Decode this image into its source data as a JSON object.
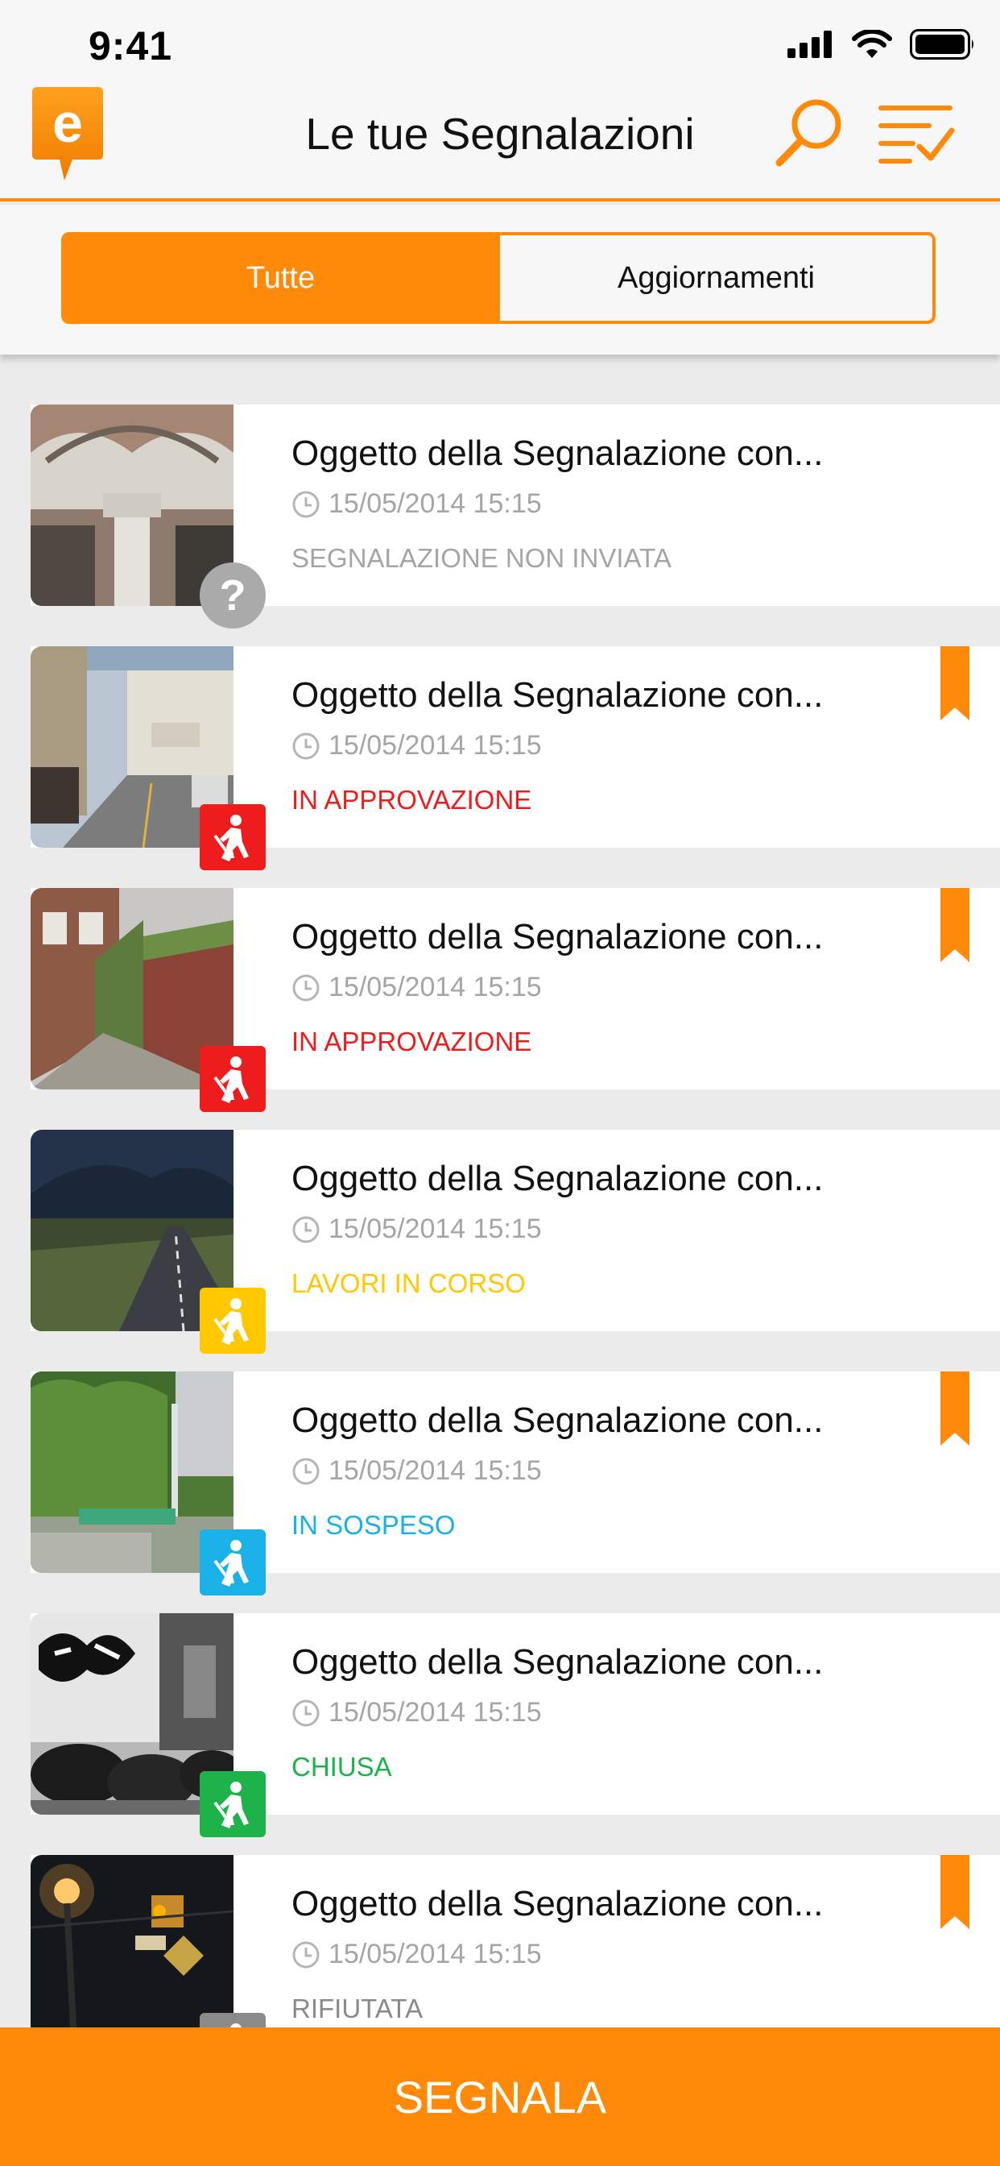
{
  "status_bar": {
    "time": "9:41"
  },
  "header": {
    "title": "Le tue Segnalazioni",
    "logo_letter": "e"
  },
  "tabs": [
    {
      "label": "Tutte",
      "active": true
    },
    {
      "label": "Aggiornamenti",
      "active": false
    }
  ],
  "reports": [
    {
      "title": "Oggetto della Segnalazione con...",
      "timestamp": "15/05/2014 15:15",
      "status": "SEGNALAZIONE NON INVIATA",
      "status_color": "#a5a5a5",
      "badge": "question",
      "badge_color": "#aaaaaa",
      "badge_text": "?",
      "bookmarked": false,
      "photo": "building-column"
    },
    {
      "title": "Oggetto della Segnalazione con...",
      "timestamp": "15/05/2014 15:15",
      "status": "IN APPROVAZIONE",
      "status_color": "#ee1c1c",
      "badge": "worker",
      "badge_color": "#ee1c1c",
      "bookmarked": true,
      "photo": "studio-street"
    },
    {
      "title": "Oggetto della Segnalazione con...",
      "timestamp": "15/05/2014 15:15",
      "status": "IN APPROVAZIONE",
      "status_color": "#ee1c1c",
      "badge": "worker",
      "badge_color": "#ee1c1c",
      "bookmarked": true,
      "photo": "brick-alley"
    },
    {
      "title": "Oggetto della Segnalazione con...",
      "timestamp": "15/05/2014 15:15",
      "status": "LAVORI IN CORSO",
      "status_color": "#ffc800",
      "badge": "worker",
      "badge_color": "#ffc800",
      "bookmarked": false,
      "photo": "mountain-road"
    },
    {
      "title": "Oggetto della Segnalazione con...",
      "timestamp": "15/05/2014 15:15",
      "status": "IN SOSPESO",
      "status_color": "#1ab0e8",
      "badge": "worker",
      "badge_color": "#1ab0e8",
      "bookmarked": true,
      "photo": "bamboo-park"
    },
    {
      "title": "Oggetto della Segnalazione con...",
      "timestamp": "15/05/2014 15:15",
      "status": "CHIUSA",
      "status_color": "#1db34a",
      "badge": "worker",
      "badge_color": "#1db34a",
      "bookmarked": false,
      "photo": "graffiti-trash"
    },
    {
      "title": "Oggetto della Segnalazione con...",
      "timestamp": "15/05/2014 15:15",
      "status": "RIFIUTATA",
      "status_color": "#8a8a8a",
      "badge": "worker",
      "badge_color": "#8a8a8a",
      "bookmarked": true,
      "photo": "night-streetlight"
    }
  ],
  "cta": {
    "label": "SEGNALA"
  },
  "colors": {
    "accent": "#ff8a0a",
    "text_muted": "#a5a5a5"
  }
}
